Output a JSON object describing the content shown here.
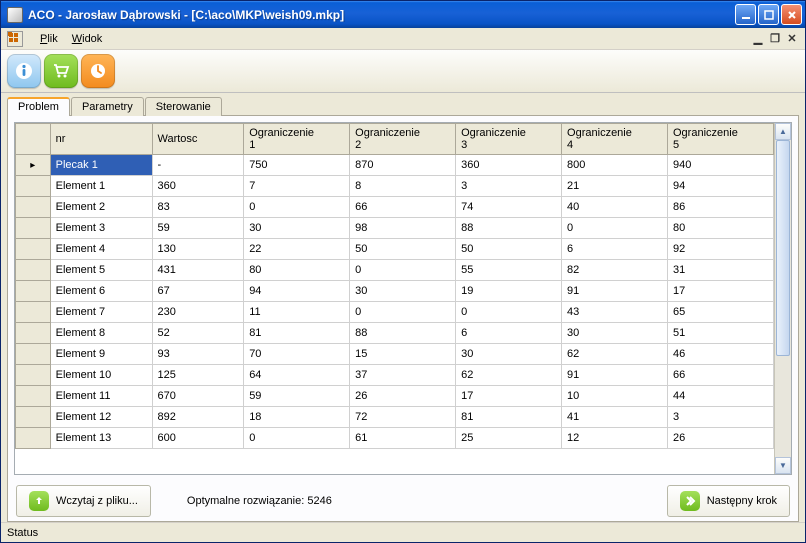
{
  "title": "ACO - Jarosław Dąbrowski - [C:\\aco\\MKP\\weish09.mkp]",
  "menu": {
    "plik": "Plik",
    "widok": "Widok"
  },
  "tabs": {
    "problem": "Problem",
    "parametry": "Parametry",
    "sterowanie": "Sterowanie"
  },
  "headers": {
    "nr": "nr",
    "wartosc": "Wartosc",
    "ogr1a": "Ograniczenie",
    "ogr1b": "1",
    "ogr2a": "Ograniczenie",
    "ogr2b": "2",
    "ogr3a": "Ograniczenie",
    "ogr3b": "3",
    "ogr4a": "Ograniczenie",
    "ogr4b": "4",
    "ogr5a": "Ograniczenie",
    "ogr5b": "5"
  },
  "rows": [
    {
      "nr": "Plecak 1",
      "val": "-",
      "c1": "750",
      "c2": "870",
      "c3": "360",
      "c4": "800",
      "c5": "940"
    },
    {
      "nr": "Element 1",
      "val": "360",
      "c1": "7",
      "c2": "8",
      "c3": "3",
      "c4": "21",
      "c5": "94"
    },
    {
      "nr": "Element 2",
      "val": "83",
      "c1": "0",
      "c2": "66",
      "c3": "74",
      "c4": "40",
      "c5": "86"
    },
    {
      "nr": "Element 3",
      "val": "59",
      "c1": "30",
      "c2": "98",
      "c3": "88",
      "c4": "0",
      "c5": "80"
    },
    {
      "nr": "Element 4",
      "val": "130",
      "c1": "22",
      "c2": "50",
      "c3": "50",
      "c4": "6",
      "c5": "92"
    },
    {
      "nr": "Element 5",
      "val": "431",
      "c1": "80",
      "c2": "0",
      "c3": "55",
      "c4": "82",
      "c5": "31"
    },
    {
      "nr": "Element 6",
      "val": "67",
      "c1": "94",
      "c2": "30",
      "c3": "19",
      "c4": "91",
      "c5": "17"
    },
    {
      "nr": "Element 7",
      "val": "230",
      "c1": "11",
      "c2": "0",
      "c3": "0",
      "c4": "43",
      "c5": "65"
    },
    {
      "nr": "Element 8",
      "val": "52",
      "c1": "81",
      "c2": "88",
      "c3": "6",
      "c4": "30",
      "c5": "51"
    },
    {
      "nr": "Element 9",
      "val": "93",
      "c1": "70",
      "c2": "15",
      "c3": "30",
      "c4": "62",
      "c5": "46"
    },
    {
      "nr": "Element 10",
      "val": "125",
      "c1": "64",
      "c2": "37",
      "c3": "62",
      "c4": "91",
      "c5": "66"
    },
    {
      "nr": "Element 11",
      "val": "670",
      "c1": "59",
      "c2": "26",
      "c3": "17",
      "c4": "10",
      "c5": "44"
    },
    {
      "nr": "Element 12",
      "val": "892",
      "c1": "18",
      "c2": "72",
      "c3": "81",
      "c4": "41",
      "c5": "3"
    },
    {
      "nr": "Element 13",
      "val": "600",
      "c1": "0",
      "c2": "61",
      "c3": "25",
      "c4": "12",
      "c5": "26"
    }
  ],
  "bottom": {
    "load": "Wczytaj z pliku...",
    "opt": "Optymalne rozwiązanie: 5246",
    "next": "Następny krok"
  },
  "status": "Status"
}
